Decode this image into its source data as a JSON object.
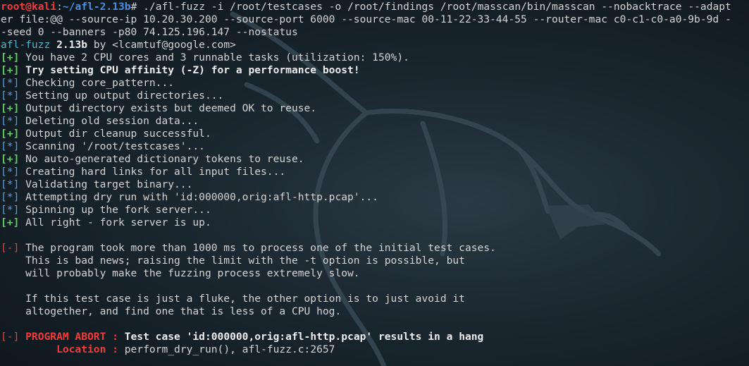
{
  "prompt": {
    "user": "root",
    "at": "@",
    "host": "kali",
    "sep": ":",
    "path": "~/afl-2.13b",
    "symbol": "#"
  },
  "command": {
    "line1": " ./afl-fuzz -i /root/testcases -o /root/findings /root/masscan/bin/masscan --nobacktrace --adapt",
    "line2": "er file:@@ --source-ip 10.20.30.200 --source-port 6000 --source-mac 00-11-22-33-44-55 --router-mac c0-c1-c0-a0-9b-9d -",
    "line3": "-seed 0 --banners -p80 74.125.196.147 --nostatus"
  },
  "banner": {
    "name": "afl-fuzz",
    "version": "2.13b",
    "by": " by <lcamtuf@google.com>"
  },
  "log": [
    {
      "mark": "[+]",
      "type": "plus",
      "text": " You have 2 CPU cores and 3 runnable tasks (utilization: 150%).",
      "bold": false
    },
    {
      "mark": "[+]",
      "type": "plus",
      "text": " Try setting CPU affinity (-Z) for a performance boost!",
      "bold": true
    },
    {
      "mark": "[*]",
      "type": "star",
      "text": " Checking core_pattern...",
      "bold": false
    },
    {
      "mark": "[*]",
      "type": "star",
      "text": " Setting up output directories...",
      "bold": false
    },
    {
      "mark": "[+]",
      "type": "plus",
      "text": " Output directory exists but deemed OK to reuse.",
      "bold": false
    },
    {
      "mark": "[*]",
      "type": "star",
      "text": " Deleting old session data...",
      "bold": false
    },
    {
      "mark": "[+]",
      "type": "plus",
      "text": " Output dir cleanup successful.",
      "bold": false
    },
    {
      "mark": "[*]",
      "type": "star",
      "text": " Scanning '/root/testcases'...",
      "bold": false
    },
    {
      "mark": "[+]",
      "type": "plus",
      "text": " No auto-generated dictionary tokens to reuse.",
      "bold": false
    },
    {
      "mark": "[*]",
      "type": "star",
      "text": " Creating hard links for all input files...",
      "bold": false
    },
    {
      "mark": "[*]",
      "type": "star",
      "text": " Validating target binary...",
      "bold": false
    },
    {
      "mark": "[*]",
      "type": "star",
      "text": " Attempting dry run with 'id:000000,orig:afl-http.pcap'...",
      "bold": false
    },
    {
      "mark": "[*]",
      "type": "star",
      "text": " Spinning up the fork server...",
      "bold": false
    },
    {
      "mark": "[+]",
      "type": "plus",
      "text": " All right - fork server is up.",
      "bold": false
    }
  ],
  "warning": {
    "mark": "[-]",
    "lines": [
      " The program took more than 1000 ms to process one of the initial test cases.",
      "    This is bad news; raising the limit with the -t option is possible, but",
      "    will probably make the fuzzing process extremely slow.",
      "",
      "    If this test case is just a fluke, the other option is to just avoid it",
      "    altogether, and find one that is less of a CPU hog."
    ]
  },
  "abort": {
    "mark": "[-]",
    "label": " PROGRAM ABORT : ",
    "message": "Test case 'id:000000,orig:afl-http.pcap' results in a hang",
    "location_label": "         Location : ",
    "location_value": "perform_dry_run(), afl-fuzz.c:2657"
  },
  "colors": {
    "background": "#131e25",
    "prompt_user": "#f03b3b",
    "prompt_path": "#4c8de0",
    "plus_mark": "#5fce5f",
    "star_mark": "#5c9ce6",
    "error": "#e5403f",
    "banner_name": "#4fb6c6"
  }
}
